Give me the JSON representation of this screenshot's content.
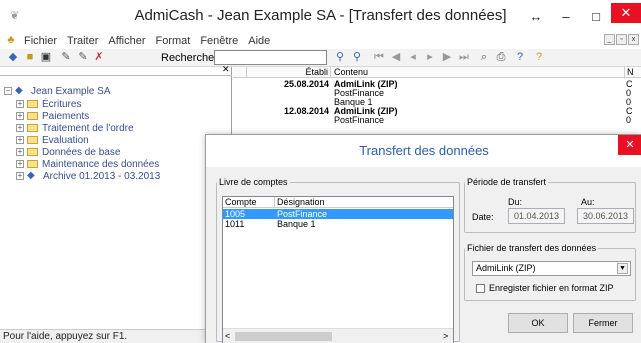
{
  "window": {
    "title": "AdmiCash - Jean Example SA - [Transfert des données]",
    "controls": [
      "↔",
      "–",
      "□",
      "✕"
    ]
  },
  "menu": [
    "Fichier",
    "Traiter",
    "Afficher",
    "Format",
    "Fenêtre",
    "Aide"
  ],
  "toolbar": {
    "search_label": "Rechercher:",
    "search_value": ""
  },
  "tree": {
    "root": "Jean Example SA",
    "items": [
      "Écritures",
      "Paiements",
      "Traitement de l'ordre",
      "Evaluation",
      "Données de base",
      "Maintenance des données",
      "Archive 01.2013 - 03.2013"
    ]
  },
  "grid": {
    "headers": [
      "Établi",
      "Contenu",
      "N"
    ],
    "rows": [
      {
        "date": "25.08.2014",
        "content": "AdmiLink (ZIP)",
        "n": "C",
        "bold": true
      },
      {
        "date": "",
        "content": "PostFinance",
        "n": "0",
        "bold": false
      },
      {
        "date": "",
        "content": "Banque 1",
        "n": "0",
        "bold": false
      },
      {
        "date": "12.08.2014",
        "content": "AdmiLink (ZIP)",
        "n": "C",
        "bold": true
      },
      {
        "date": "",
        "content": "PostFinance",
        "n": "0",
        "bold": false
      }
    ]
  },
  "status": "Pour l'aide, appuyez sur F1.",
  "dialog": {
    "title": "Transfert des données",
    "close": "✕",
    "books": {
      "legend": "Livre de comptes",
      "headers": [
        "Compte",
        "Désignation"
      ],
      "rows": [
        {
          "account": "1005",
          "name": "PostFinance",
          "selected": true
        },
        {
          "account": "1011",
          "name": "Banque 1",
          "selected": false
        }
      ]
    },
    "period": {
      "legend": "Période de transfert",
      "from_label": "Du:",
      "to_label": "Au:",
      "date_label": "Date:",
      "from": "01.04.2013",
      "to": "30.06.2013"
    },
    "file": {
      "legend": "Fichier de transfert des données",
      "format": "AdmiLink (ZIP)",
      "save_label": "Enregister fichier en format ZIP"
    },
    "ok": "OK",
    "cancel": "Fermer"
  },
  "colors": {
    "selection": "#3399ff",
    "close": "#e81123",
    "dialog_title": "#2b5fa8",
    "tree_text": "#3a4e8a"
  }
}
